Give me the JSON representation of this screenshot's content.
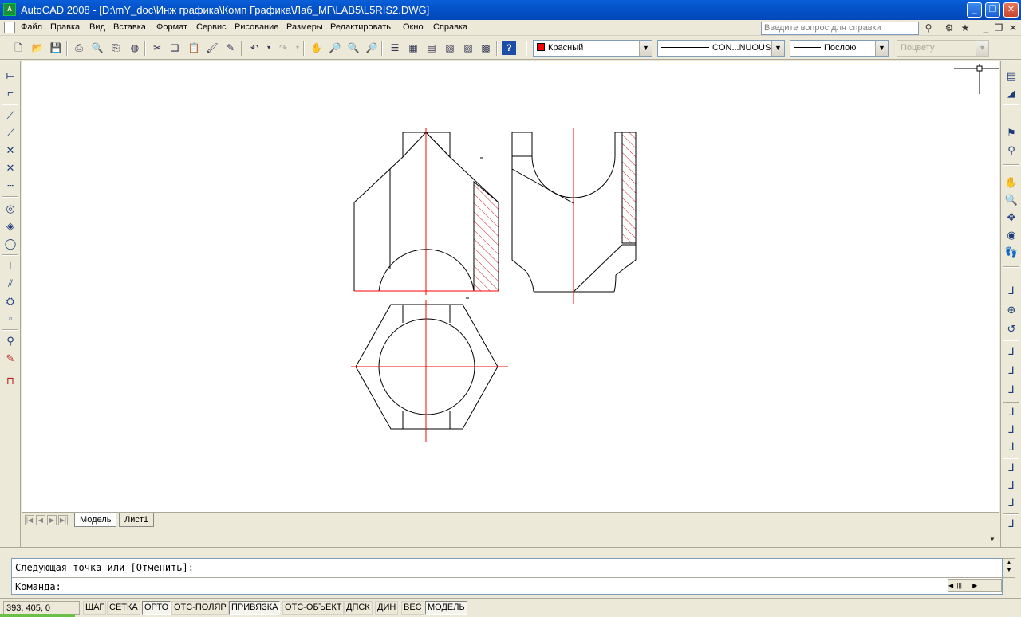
{
  "window": {
    "title": "AutoCAD 2008 - [D:\\mY_doc\\Инж графика\\Комп Графика\\Лаб_МГ\\LAB5\\L5RIS2.DWG]",
    "app_icon": "autocad-logo-icon"
  },
  "menu": {
    "items": [
      "Файл",
      "Правка",
      "Вид",
      "Вставка",
      "Формат",
      "Сервис",
      "Рисование",
      "Размеры",
      "Редактировать",
      "Окно",
      "Справка"
    ],
    "help_placeholder": "Введите вопрос для справки"
  },
  "toolbar": {
    "color": "Красный",
    "color_hex": "#ff0000",
    "linetype": "CON...NUOUS",
    "lineweight": "Послою",
    "plotstyle": "Поцвету"
  },
  "tabs": {
    "items": [
      "Модель",
      "Лист1"
    ],
    "active": "Модель"
  },
  "command": {
    "history": "Следующая точка или [Отменить]:",
    "prompt": "Команда:"
  },
  "status": {
    "coords": "393, 405, 0",
    "toggles": [
      {
        "label": "ШАГ",
        "on": false
      },
      {
        "label": "СЕТКА",
        "on": false
      },
      {
        "label": "ОРТО",
        "on": true
      },
      {
        "label": "ОТС-ПОЛЯР",
        "on": false
      },
      {
        "label": "ПРИВЯЗКА",
        "on": true
      },
      {
        "label": "ОТС-ОБЪЕКТ",
        "on": false
      },
      {
        "label": "ДПСК",
        "on": false
      },
      {
        "label": "ДИН",
        "on": false
      },
      {
        "label": "ВЕС",
        "on": false
      },
      {
        "label": "МОДЕЛЬ",
        "on": true
      }
    ]
  },
  "drawing": {
    "line_color": "#000000",
    "axis_color": "#ff0000",
    "hatch_color": "#cc2222"
  }
}
